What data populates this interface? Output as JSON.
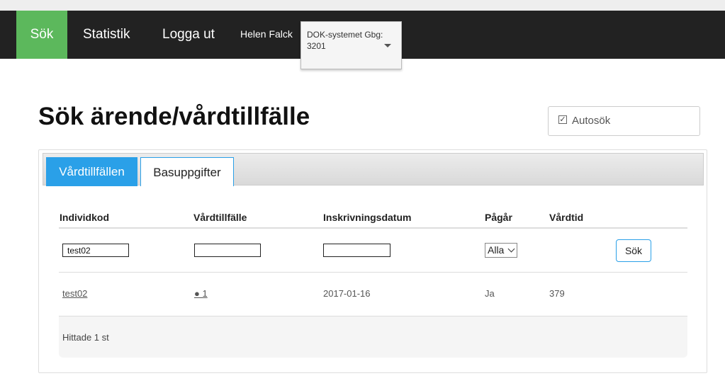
{
  "nav": {
    "items": [
      {
        "label": "Sök",
        "active": true
      },
      {
        "label": "Statistik"
      },
      {
        "label": "Logga ut"
      }
    ],
    "user": "Helen Falck",
    "unit_select": {
      "line1": "DOK-systemet Gbg:",
      "line2": "3201"
    }
  },
  "page": {
    "title": "Sök ärende/vårdtillfälle",
    "autosok_label": "Autosök",
    "autosok_checked": true
  },
  "tabs": [
    {
      "label": "Vårdtillfällen",
      "active": true
    },
    {
      "label": "Basuppgifter",
      "active": false
    }
  ],
  "table": {
    "columns": [
      "Individkod",
      "Vårdtillfälle",
      "Inskrivningsdatum",
      "Pågår",
      "Vårdtid"
    ],
    "filters": {
      "individkod": "test02",
      "vardtillfalle": "",
      "inskrivningsdatum": "",
      "pagar": "Alla"
    },
    "search_button": "Sök",
    "rows": [
      {
        "individkod": "test02",
        "vardtillfalle": "● 1",
        "inskrivningsdatum": "2017-01-16",
        "pagar": "Ja",
        "vardtid": "379"
      }
    ],
    "footer": "Hittade 1 st"
  },
  "colors": {
    "nav_bg": "#222222",
    "active_green": "#5cb85c",
    "tab_blue": "#2aa0e8"
  }
}
